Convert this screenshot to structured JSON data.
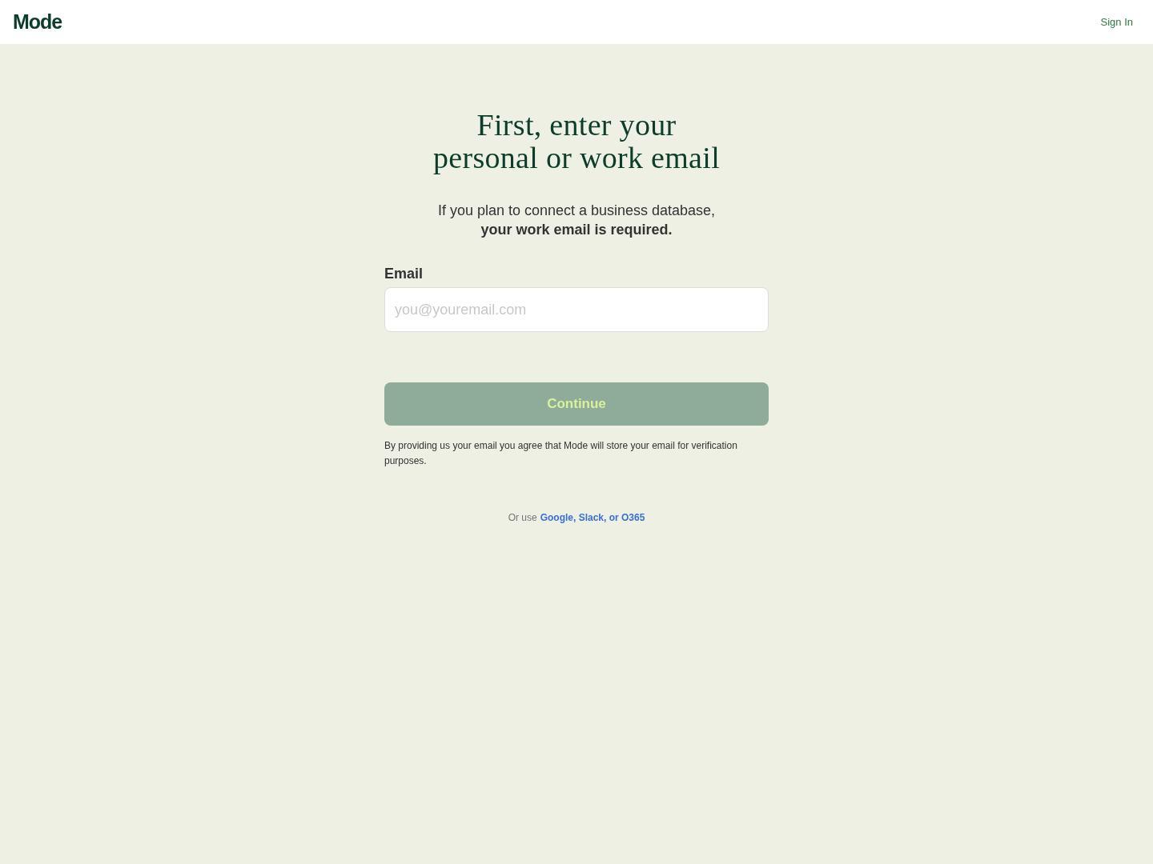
{
  "header": {
    "logo": "Mode",
    "sign_in": "Sign In"
  },
  "main": {
    "title": "First, enter your\npersonal or work email",
    "subtitle": "If you plan to connect a business database,\n**your work email is required.**",
    "email_field": {
      "label": "Email",
      "placeholder": "you@youremail.com"
    },
    "continue_button": {
      "label": "Continue",
      "disabled": true
    },
    "disclaimer": "By providing us your email you agree that Mode will store your email for verification purposes.",
    "alternatives": {
      "prefix": "Or use",
      "link": "Google, Slack, or O365"
    }
  }
}
